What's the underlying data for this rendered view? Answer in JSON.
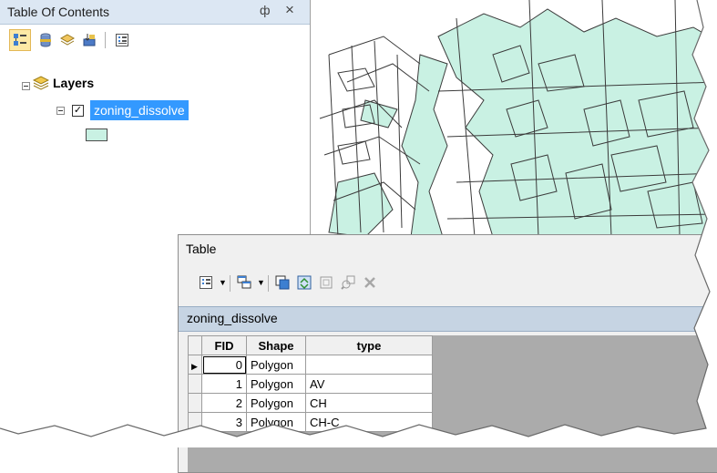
{
  "toc": {
    "title": "Table Of Contents",
    "pin_glyph": "⌖",
    "close_glyph": "×",
    "tools": [
      "list-by-drawing-order-icon",
      "list-by-source-icon",
      "list-by-visibility-icon",
      "list-by-selection-icon",
      "options-icon"
    ],
    "layers_label": "Layers",
    "layer": {
      "name": "zoning_dissolve",
      "checked": true,
      "symbol_color": "#c9f1e3"
    }
  },
  "table_window": {
    "title": "Table",
    "layer_name": "zoning_dissolve",
    "columns": [
      "FID",
      "Shape",
      "type"
    ],
    "rows": [
      {
        "fid": "0",
        "shape": "Polygon",
        "type": ""
      },
      {
        "fid": "1",
        "shape": "Polygon",
        "type": "AV"
      },
      {
        "fid": "2",
        "shape": "Polygon",
        "type": "CH"
      },
      {
        "fid": "3",
        "shape": "Polygon",
        "type": "CH-C"
      }
    ],
    "tools": [
      "table-options-icon",
      "related-tables-icon",
      "select-by-attributes-icon",
      "switch-selection-icon",
      "clear-selection-icon",
      "zoom-to-selected-icon",
      "delete-selected-icon"
    ]
  },
  "colors": {
    "toc_title_bg": "#dce7f3",
    "selection_blue": "#3399ff",
    "polygon_fill": "#c9f1e3",
    "layer_bar": "#c6d4e3"
  }
}
